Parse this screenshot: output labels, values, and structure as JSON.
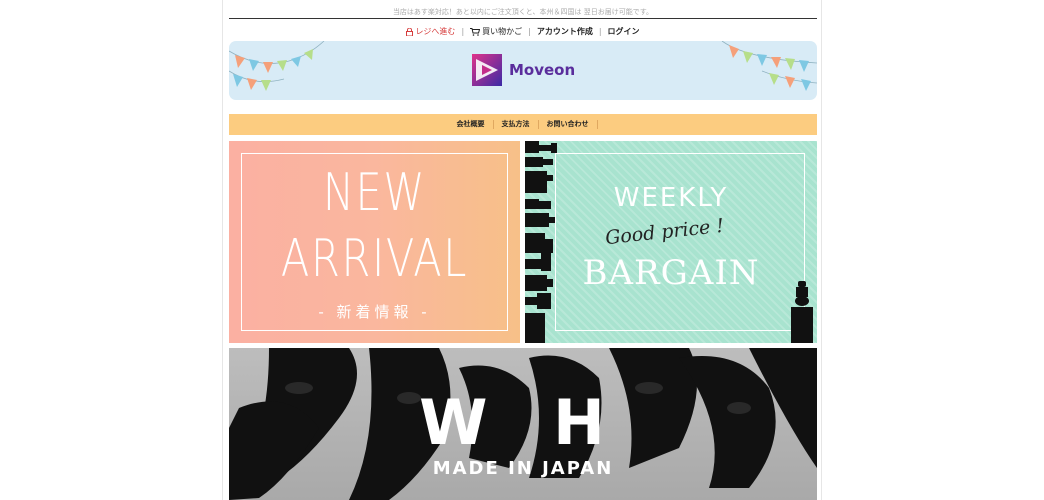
{
  "notice": "当店はあす楽対応！あと以内にご注文頂くと、本州＆四国は 翌日お届け可能です。",
  "topnav": {
    "checkout": "レジへ進む",
    "cart": "買い物かご",
    "signup": "アカウント作成",
    "login": "ログイン"
  },
  "brand": {
    "name": "Moveon"
  },
  "menu": [
    "会社概要",
    "支払方法",
    "お問い合わせ"
  ],
  "tiles": {
    "new_arrival": {
      "line1": "NEW",
      "line2": "ARRIVAL",
      "sub": "- 新着情報 -"
    },
    "weekly": {
      "line1": "WEEKLY",
      "line2": "Good price !",
      "line3": "BARGAIN"
    }
  },
  "hero": {
    "title": "W H",
    "subtitle": "MADE IN JAPAN"
  },
  "colors": {
    "banner_bg": "#d8ebf6",
    "menu_bg": "#fccc80",
    "checkout": "#d63c3c",
    "brand": "#5a2d9c"
  }
}
